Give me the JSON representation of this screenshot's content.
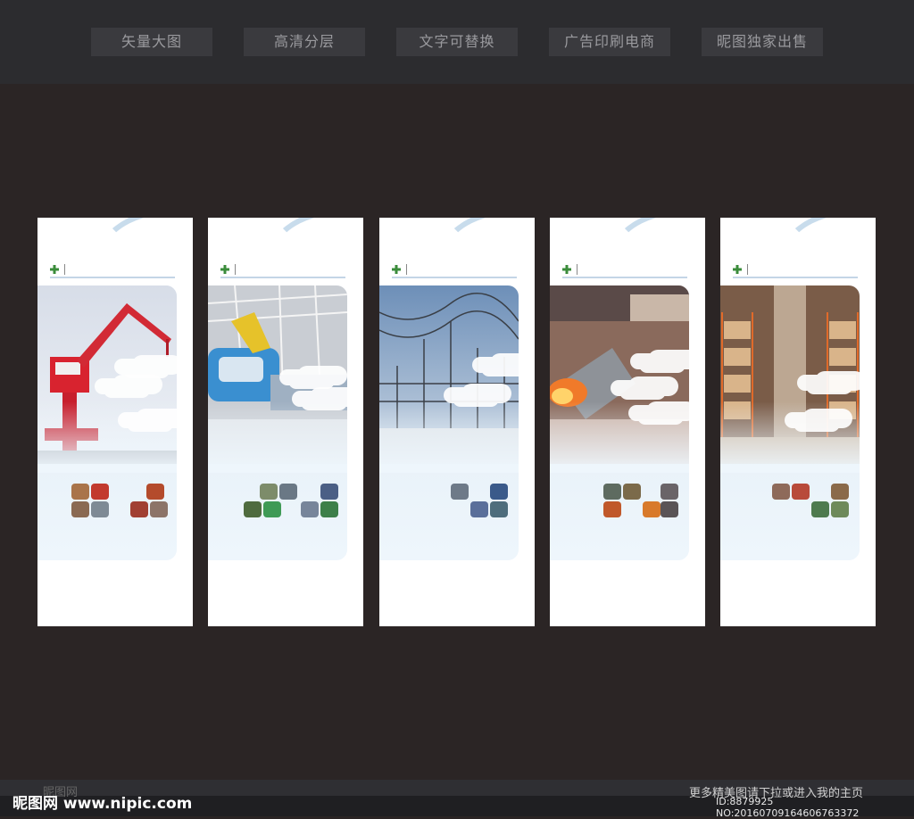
{
  "top_tags": [
    "矢量大图",
    "高清分层",
    "文字可替换",
    "广告印刷电商",
    "昵图独家出售"
  ],
  "panels": [
    {
      "name": "port",
      "photo": "port-crane-photo"
    },
    {
      "name": "manufacturing",
      "photo": "car-assembly-photo"
    },
    {
      "name": "power",
      "photo": "substation-photo"
    },
    {
      "name": "steel",
      "photo": "steel-mill-photo"
    },
    {
      "name": "warehouse",
      "photo": "warehouse-racks-photo"
    }
  ],
  "footer": {
    "brand": "昵图网 www.nipic.com",
    "faint_text": "昵图网",
    "hint": "更多精美图请下拉或进入我的主页",
    "id_line": "ID:8879925 NO:20160709164606763372"
  },
  "colors": {
    "background": "#2b2525",
    "topbar": "#2c2c2f",
    "tag_bg": "#3a3a3e",
    "panel": "#ffffff",
    "accent_blue": "#1c5aa0",
    "logo_green": "#3b8c3b"
  }
}
